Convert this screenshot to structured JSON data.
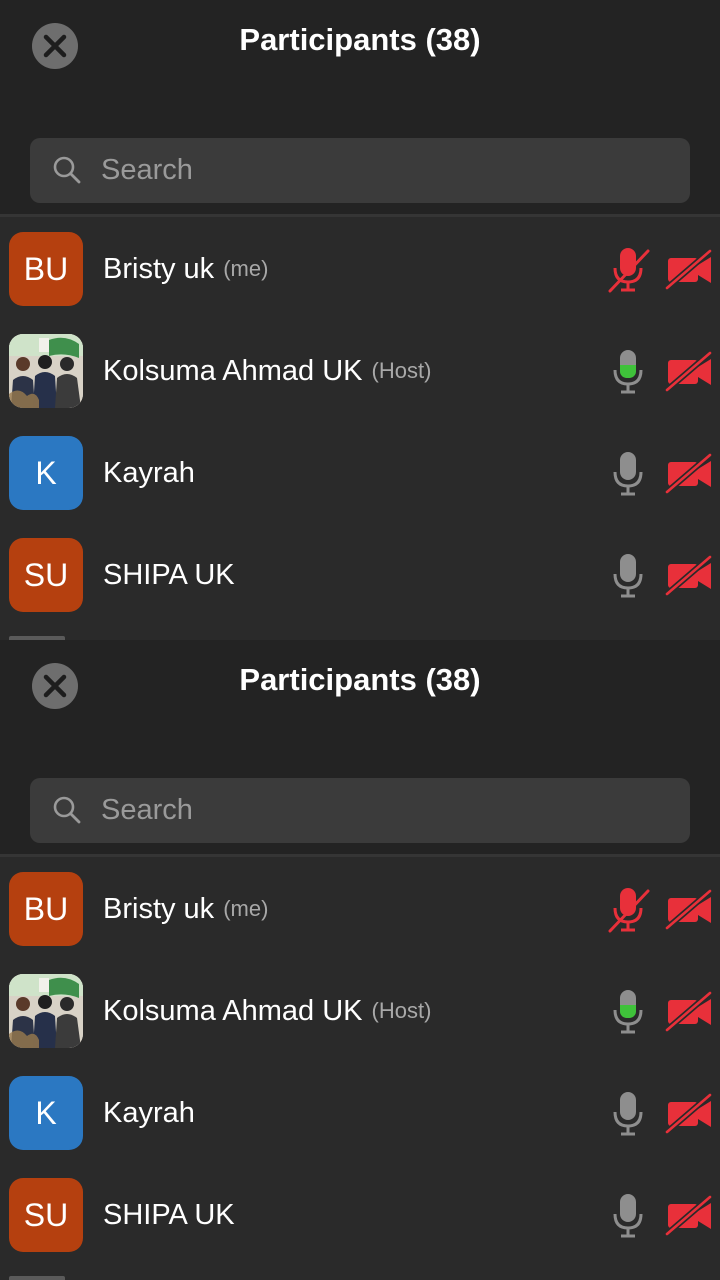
{
  "panels": [
    {
      "title": "Participants (38)",
      "search": {
        "placeholder": "Search",
        "value": ""
      },
      "participants": [
        {
          "initials": "BU",
          "name": "Bristy uk",
          "tag": "(me)",
          "avatar_color": "#b5400f",
          "avatar_type": "initials",
          "mic": "muted",
          "camera": "off"
        },
        {
          "initials": "",
          "name": "Kolsuma Ahmad UK",
          "tag": "(Host)",
          "avatar_color": "#d9d3c8",
          "avatar_type": "photo",
          "mic": "speaking",
          "camera": "off"
        },
        {
          "initials": "K",
          "name": "Kayrah",
          "tag": "",
          "avatar_color": "#2b78c2",
          "avatar_type": "initials",
          "mic": "on",
          "camera": "off"
        },
        {
          "initials": "SU",
          "name": "SHIPA UK",
          "tag": "",
          "avatar_color": "#b5400f",
          "avatar_type": "initials",
          "mic": "on",
          "camera": "off"
        }
      ]
    },
    {
      "title": "Participants (38)",
      "search": {
        "placeholder": "Search",
        "value": ""
      },
      "participants": [
        {
          "initials": "BU",
          "name": "Bristy uk",
          "tag": "(me)",
          "avatar_color": "#b5400f",
          "avatar_type": "initials",
          "mic": "muted",
          "camera": "off"
        },
        {
          "initials": "",
          "name": "Kolsuma Ahmad UK",
          "tag": "(Host)",
          "avatar_color": "#d9d3c8",
          "avatar_type": "photo",
          "mic": "speaking",
          "camera": "off"
        },
        {
          "initials": "K",
          "name": "Kayrah",
          "tag": "",
          "avatar_color": "#2b78c2",
          "avatar_type": "initials",
          "mic": "on",
          "camera": "off"
        },
        {
          "initials": "SU",
          "name": "SHIPA UK",
          "tag": "",
          "avatar_color": "#b5400f",
          "avatar_type": "initials",
          "mic": "on",
          "camera": "off"
        }
      ]
    }
  ],
  "icons": {
    "close": "close-icon",
    "search": "search-icon",
    "mic_muted": "mic-muted-icon",
    "mic_on": "mic-icon",
    "camera_off": "camera-off-icon"
  },
  "colors": {
    "muted_red": "#e8303a",
    "speaking_green": "#3fc23a",
    "mic_gray": "#8e8e8e"
  }
}
